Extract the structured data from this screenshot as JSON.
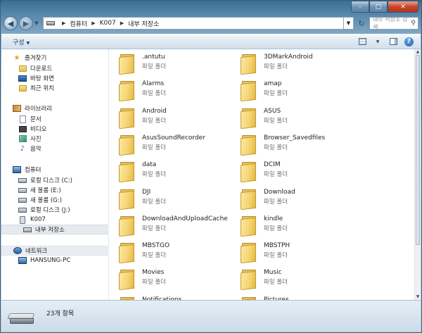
{
  "window": {
    "minimize_label": "–",
    "maximize_label": "□",
    "close_label": "✕"
  },
  "navbar": {
    "breadcrumb": [
      "컴퓨터",
      "K007",
      "내부 저장소"
    ],
    "search_placeholder": "내부 저장소 검색"
  },
  "toolbar": {
    "organize_label": "구성"
  },
  "sidebar": {
    "favorites": {
      "header": "즐겨찾기",
      "items": [
        "다운로드",
        "바탕 화면",
        "최근 위치"
      ]
    },
    "libraries": {
      "header": "라이브러리",
      "items": [
        "문서",
        "비디오",
        "사진",
        "음악"
      ]
    },
    "computer": {
      "header": "컴퓨터",
      "items": [
        "로컬 디스크 (C:)",
        "새 볼륨 (E:)",
        "새 볼륨 (G:)",
        "로컬 디스크 (J:)",
        "K007",
        "내부 저장소"
      ]
    },
    "network": {
      "header": "네트워크",
      "items": [
        "HANSUNG-PC"
      ]
    }
  },
  "files": {
    "type_label": "파일 폴더",
    "left": [
      ".antutu",
      "Alarms",
      "Android",
      "AsusSoundRecorder",
      "data",
      "DJI",
      "DownloadAndUploadCache",
      "MBSTGO",
      "Movies",
      "Notifications"
    ],
    "right": [
      "3DMarkAndroid",
      "amap",
      "ASUS",
      "Browser_Savedfiles",
      "DCIM",
      "Download",
      "kindle",
      "MBSTPH",
      "Music",
      "Pictures"
    ]
  },
  "details": {
    "item_count": "23개 항목"
  },
  "colors": {
    "title_gradient_top": "#3a6f96",
    "selected_bg": "#e6eaee",
    "folder_yellow": "#f5d674"
  }
}
